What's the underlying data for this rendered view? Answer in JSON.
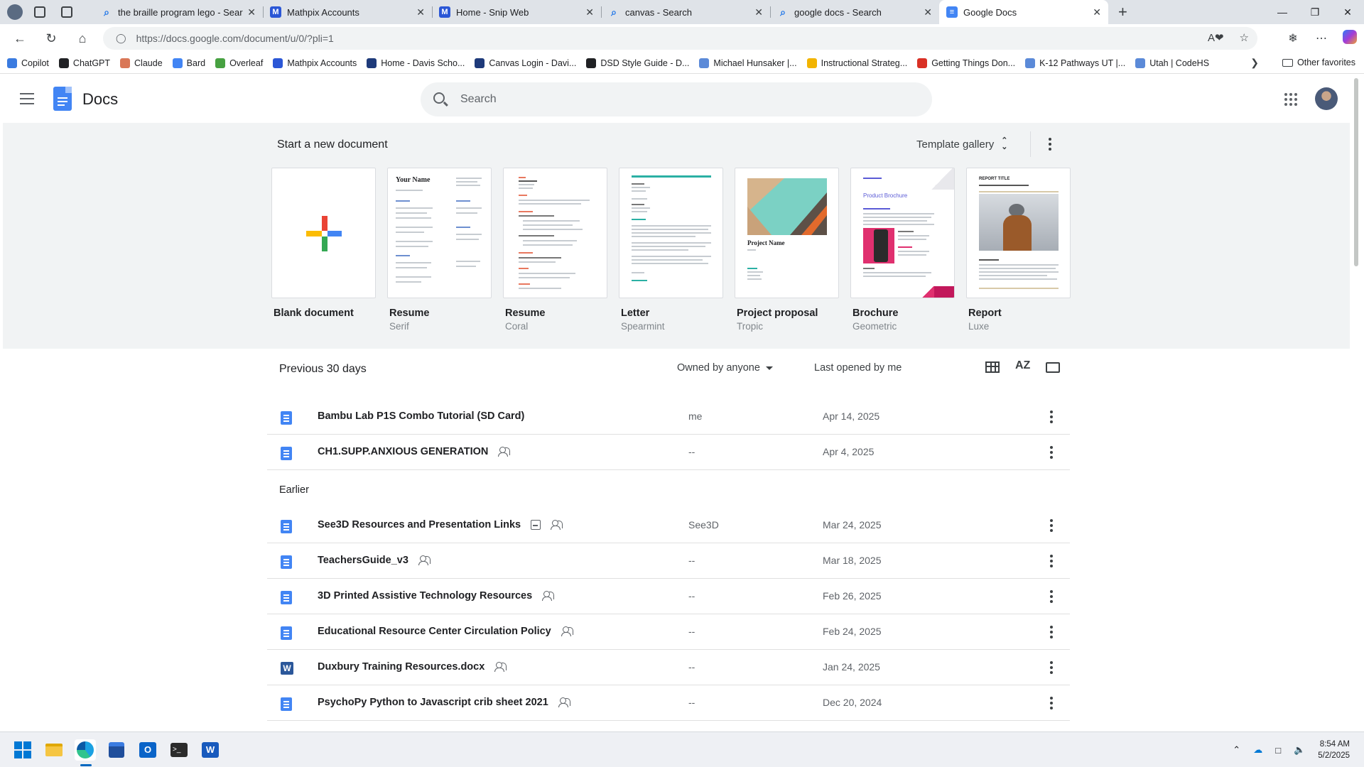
{
  "browser": {
    "tabs": [
      {
        "title": "the braille program lego - Search",
        "favicon": "search-icon",
        "active": false
      },
      {
        "title": "Mathpix Accounts",
        "favicon": "mathpix-icon",
        "active": false
      },
      {
        "title": "Home - Snip Web",
        "favicon": "mathpix-icon",
        "active": false
      },
      {
        "title": "canvas - Search",
        "favicon": "search-icon",
        "active": false
      },
      {
        "title": "google docs - Search",
        "favicon": "search-icon",
        "active": false
      },
      {
        "title": "Google Docs",
        "favicon": "docs-icon",
        "active": true
      }
    ],
    "url": "https://docs.google.com/document/u/0/?pli=1",
    "bookmarks": [
      {
        "label": "Copilot",
        "color": "#3a7be0"
      },
      {
        "label": "ChatGPT",
        "color": "#202124"
      },
      {
        "label": "Claude",
        "color": "#d97757"
      },
      {
        "label": "Bard",
        "color": "#4285f4"
      },
      {
        "label": "Overleaf",
        "color": "#47a141"
      },
      {
        "label": "Mathpix Accounts",
        "color": "#2b57d6"
      },
      {
        "label": "Home - Davis Scho...",
        "color": "#1e3a7a"
      },
      {
        "label": "Canvas Login - Davi...",
        "color": "#1e3a7a"
      },
      {
        "label": "DSD Style Guide - D...",
        "color": "#202124"
      },
      {
        "label": "Michael Hunsaker |...",
        "color": "#5b8ad8"
      },
      {
        "label": "Instructional Strateg...",
        "color": "#f2b400"
      },
      {
        "label": "Getting Things Don...",
        "color": "#d93025"
      },
      {
        "label": "K-12 Pathways UT |...",
        "color": "#5b8ad8"
      },
      {
        "label": "Utah | CodeHS",
        "color": "#5b8ad8"
      }
    ],
    "other_favorites": "Other favorites"
  },
  "docs": {
    "app_name": "Docs",
    "search_placeholder": "Search",
    "start_new": "Start a new document",
    "template_gallery": "Template gallery",
    "templates": [
      {
        "name": "Blank document",
        "sub": ""
      },
      {
        "name": "Resume",
        "sub": "Serif"
      },
      {
        "name": "Resume",
        "sub": "Coral"
      },
      {
        "name": "Letter",
        "sub": "Spearmint"
      },
      {
        "name": "Project proposal",
        "sub": "Tropic"
      },
      {
        "name": "Brochure",
        "sub": "Geometric"
      },
      {
        "name": "Report",
        "sub": "Luxe"
      }
    ],
    "thumb_text": {
      "your_name": "Your Name",
      "project_name": "Project Name",
      "product_brochure": "Product Brochure",
      "report_title": "REPORT TITLE"
    },
    "recent_label": "Previous 30 days",
    "earlier_label": "Earlier",
    "owner_filter": "Owned by anyone",
    "sort_label": "Last opened by me",
    "sort_icon": "AZ",
    "recent_docs": [
      {
        "title": "Bambu Lab P1S Combo Tutorial (SD Card)",
        "owner": "me",
        "date": "Apr 14, 2025",
        "type": "doc",
        "shared": false,
        "offline": false
      },
      {
        "title": "CH1.SUPP.ANXIOUS GENERATION",
        "owner": "--",
        "date": "Apr 4, 2025",
        "type": "doc",
        "shared": true,
        "offline": false
      }
    ],
    "earlier_docs": [
      {
        "title": "See3D Resources and Presentation Links",
        "owner": "See3D",
        "date": "Mar 24, 2025",
        "type": "doc",
        "shared": true,
        "offline": true
      },
      {
        "title": "TeachersGuide_v3",
        "owner": "--",
        "date": "Mar 18, 2025",
        "type": "doc",
        "shared": true,
        "offline": false
      },
      {
        "title": "3D Printed Assistive Technology Resources",
        "owner": "--",
        "date": "Feb 26, 2025",
        "type": "doc",
        "shared": true,
        "offline": false
      },
      {
        "title": "Educational Resource Center Circulation Policy",
        "owner": "--",
        "date": "Feb 24, 2025",
        "type": "doc",
        "shared": true,
        "offline": false
      },
      {
        "title": "Duxbury Training Resources.docx",
        "owner": "--",
        "date": "Jan 24, 2025",
        "type": "word",
        "shared": true,
        "offline": false
      },
      {
        "title": "PsychoPy Python to Javascript crib sheet 2021",
        "owner": "--",
        "date": "Dec 20, 2024",
        "type": "doc",
        "shared": true,
        "offline": false
      }
    ]
  },
  "taskbar": {
    "time": "8:54 AM",
    "date": "5/2/2025"
  }
}
